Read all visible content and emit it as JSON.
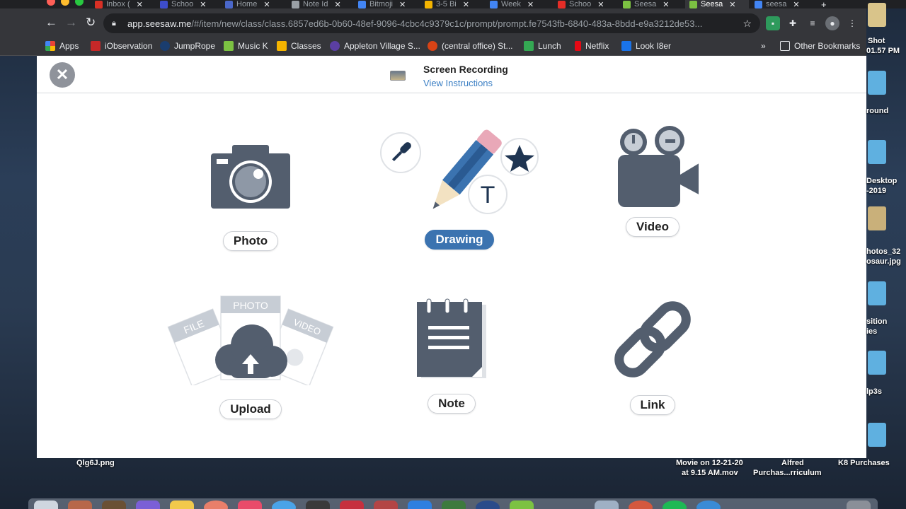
{
  "tabs": [
    {
      "label": "Inbox (",
      "color": "#d93025"
    },
    {
      "label": "Schoo",
      "color": "#3d4dcc"
    },
    {
      "label": "Home",
      "color": "#4a67c9"
    },
    {
      "label": "Note Id",
      "color": "#9aa0a6"
    },
    {
      "label": "Bitmoji",
      "color": "#4285f4"
    },
    {
      "label": "3-5 Bi",
      "color": "#f4b400"
    },
    {
      "label": "Week",
      "color": "#4285f4"
    },
    {
      "label": "Schoo",
      "color": "#e52d27"
    },
    {
      "label": "Seesa",
      "color": "#7cc242"
    },
    {
      "label": "Seesa",
      "color": "#7cc242"
    },
    {
      "label": "seesa",
      "color": "#4285f4"
    }
  ],
  "toolbar": {
    "back_icon": "back-arrow-icon",
    "forward_icon": "forward-arrow-icon",
    "reload_icon": "reload-icon",
    "url_host": "app.seesaw.me",
    "url_path": "/#/item/new/class/class.6857ed6b-0b60-48ef-9096-4cbc4c9379c1c/prompt/prompt.fe7543fb-6840-483a-8bdd-e9a3212de53..."
  },
  "bookmarks": [
    {
      "label": "Apps",
      "color": "#ea4335"
    },
    {
      "label": "iObservation",
      "color": "#c62828"
    },
    {
      "label": "JumpRope",
      "color": "#1a3d6e"
    },
    {
      "label": "Music K",
      "color": "#7cc242"
    },
    {
      "label": "Classes",
      "color": "#f4b400"
    },
    {
      "label": "Appleton Village S...",
      "color": "#5b3fa3"
    },
    {
      "label": "(central office) St...",
      "color": "#d84315"
    },
    {
      "label": "Lunch",
      "color": "#34a853"
    },
    {
      "label": "Netflix",
      "color": "#e50914"
    },
    {
      "label": "Look I8er",
      "color": "#1a73e8"
    }
  ],
  "bookmarks_more": "»",
  "other_bookmarks": "Other Bookmarks",
  "header": {
    "title": "Screen Recording",
    "link": "View Instructions",
    "close_icon": "close-icon"
  },
  "options": {
    "photo": "Photo",
    "drawing": "Drawing",
    "video": "Video",
    "upload": "Upload",
    "note": "Note",
    "link": "Link"
  },
  "upload_icon_labels": {
    "file": "FILE",
    "photo": "PHOTO",
    "video": "VIDEO"
  },
  "drawing_icon_text": "T",
  "desktop": {
    "right_labels": [
      "Shot",
      "01.57 PM",
      "round",
      "Desktop",
      "-2019",
      "hotos_32",
      "osaur.jpg",
      "sition",
      "ies",
      "lp3s"
    ],
    "bottom_left": "Qlg6J.png",
    "bottom_movie_1": "Movie on 12-21-20",
    "bottom_movie_2": "at 9.15 AM.mov",
    "bottom_alfred_1": "Alfred",
    "bottom_alfred_2": "Purchas...rriculum",
    "bottom_k8": "K8 Purchases"
  },
  "colors": {
    "accent_blue": "#3b73b0",
    "icon_slate": "#535e6e",
    "link_blue": "#3b7fc4"
  }
}
